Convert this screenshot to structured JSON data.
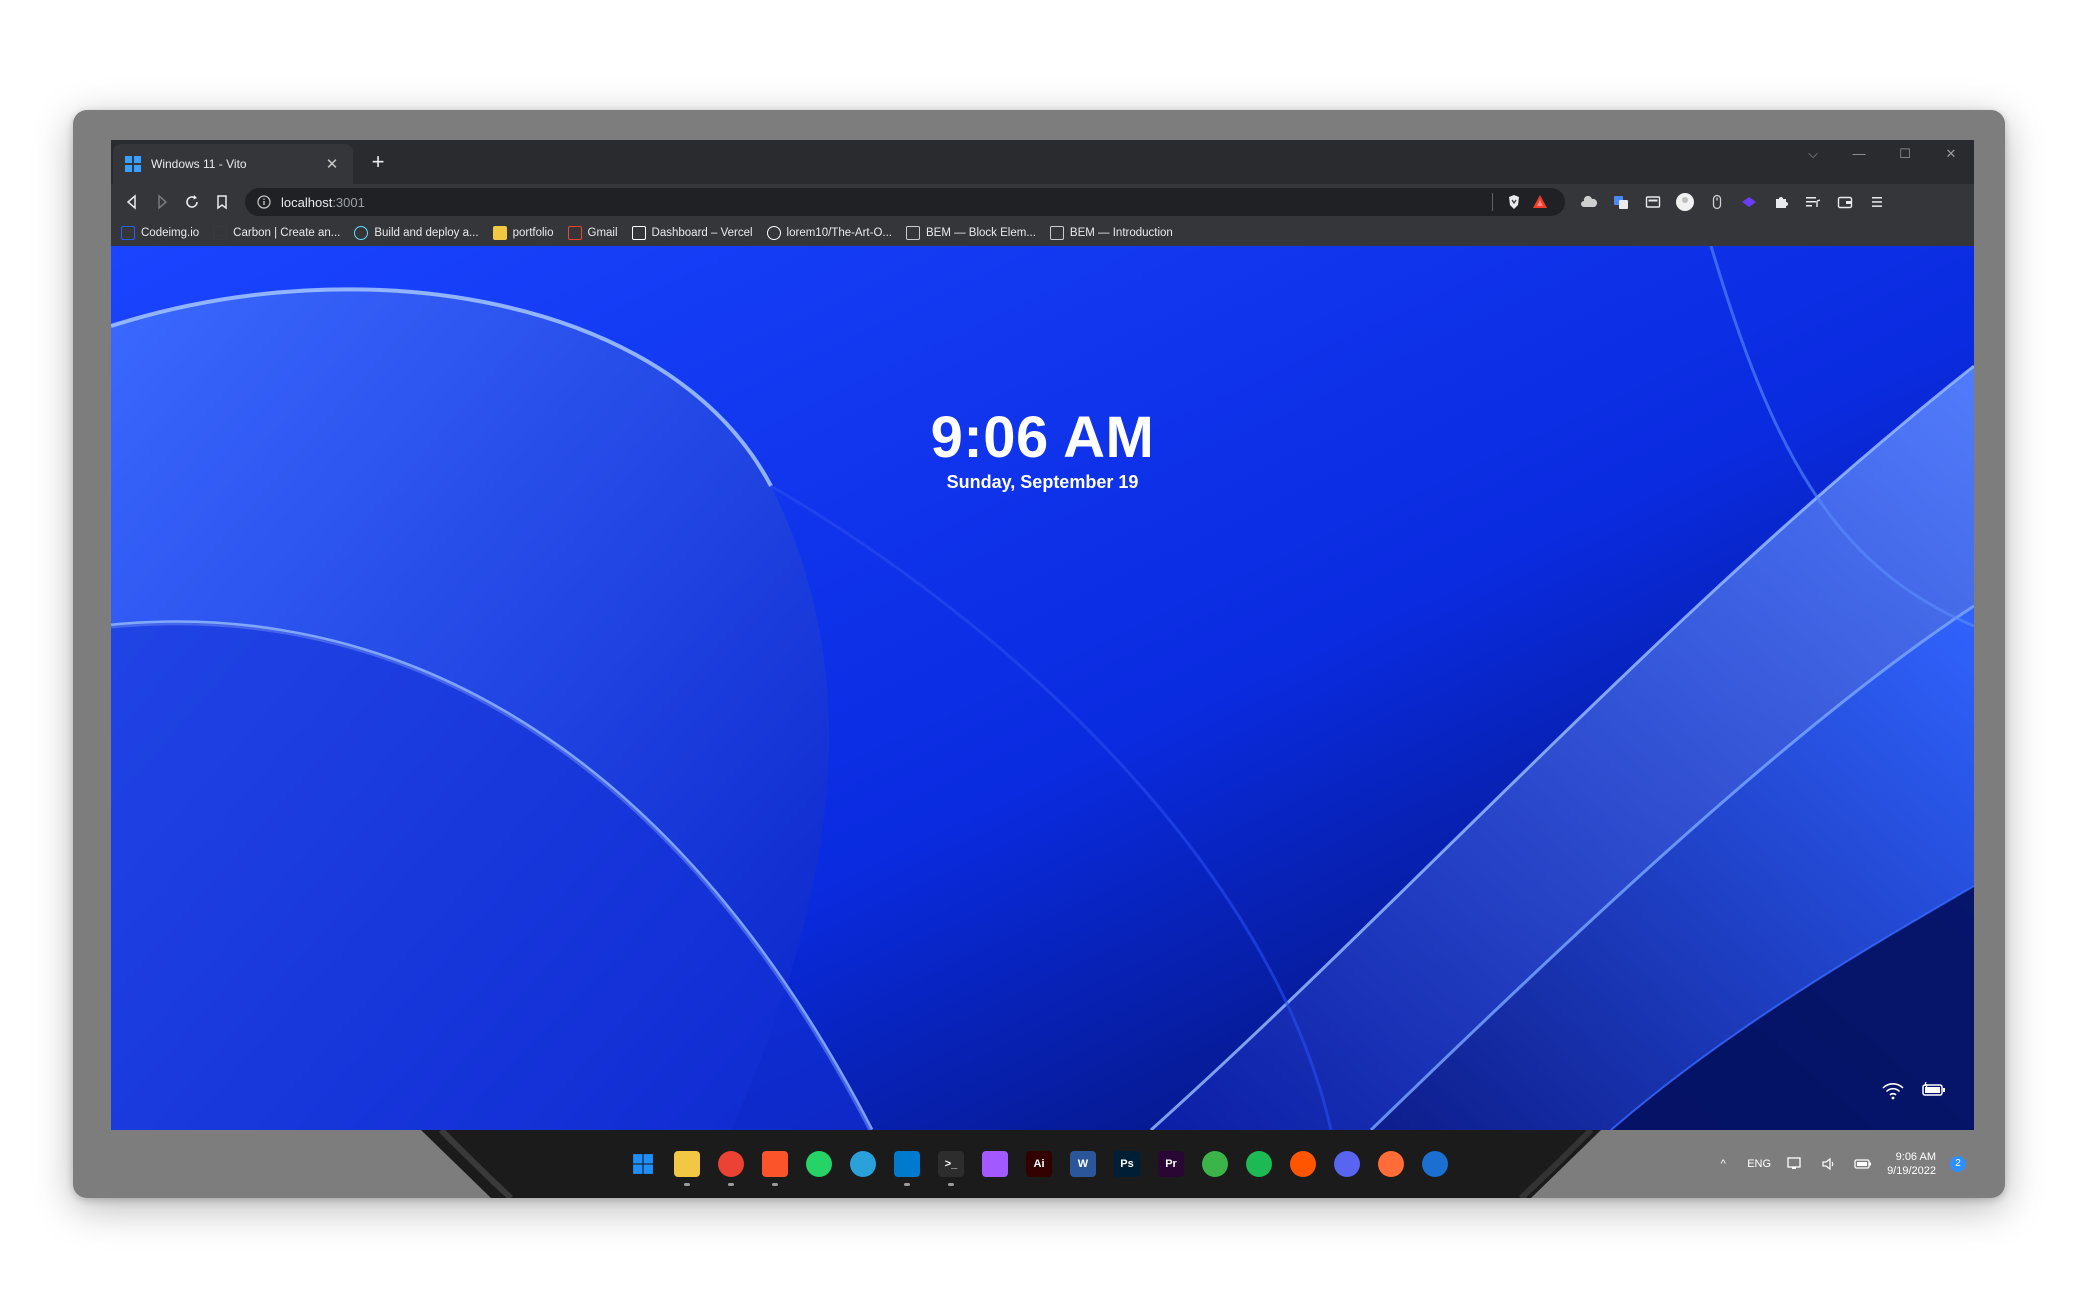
{
  "tab": {
    "title": "Windows 11 - Vito",
    "favicon": "windows-logo-icon",
    "close": "✕",
    "new_tab": "+"
  },
  "window_controls": {
    "dropdown": "⌵",
    "minimize": "—",
    "maximize": "☐",
    "close": "✕"
  },
  "omnibox": {
    "host": "localhost",
    "port": ":3001"
  },
  "bookmarks": [
    {
      "label": "Codeimg.io",
      "icon": "codeimg-icon",
      "color": "#2b5cff"
    },
    {
      "label": "Carbon | Create an...",
      "icon": "carbon-icon",
      "color": "#3a3a3a"
    },
    {
      "label": "Build and deploy a...",
      "icon": "react-icon",
      "color": "#61dafb"
    },
    {
      "label": "portfolio",
      "icon": "folder-icon",
      "color": "#f2c744"
    },
    {
      "label": "Gmail",
      "icon": "gmail-icon",
      "color": "#ea4335"
    },
    {
      "label": "Dashboard – Vercel",
      "icon": "vercel-icon",
      "color": "#ffffff"
    },
    {
      "label": "lorem10/The-Art-O...",
      "icon": "github-icon",
      "color": "#ffffff"
    },
    {
      "label": "BEM — Block Elem...",
      "icon": "bem-icon",
      "color": "#cccccc"
    },
    {
      "label": "BEM — Introduction",
      "icon": "bem-icon",
      "color": "#cccccc"
    }
  ],
  "lockscreen": {
    "time": "9:06 AM",
    "date": "Sunday, September 19"
  },
  "taskbar": {
    "apps": [
      {
        "name": "start-button",
        "icon": "windows-logo-icon",
        "bg": "#1f8fff",
        "glyph": ""
      },
      {
        "name": "file-explorer",
        "icon": "folder-icon",
        "bg": "#f2c744",
        "glyph": ""
      },
      {
        "name": "chrome",
        "icon": "chrome-icon",
        "bg": "#ea4335",
        "glyph": ""
      },
      {
        "name": "brave",
        "icon": "brave-icon",
        "bg": "#fb542b",
        "glyph": ""
      },
      {
        "name": "whatsapp",
        "icon": "whatsapp-icon",
        "bg": "#25d366",
        "glyph": ""
      },
      {
        "name": "telegram",
        "icon": "telegram-icon",
        "bg": "#2aa1da",
        "glyph": ""
      },
      {
        "name": "vscode",
        "icon": "vscode-icon",
        "bg": "#007acc",
        "glyph": ""
      },
      {
        "name": "terminal",
        "icon": "terminal-icon",
        "bg": "#2d2d2d",
        "glyph": ">_"
      },
      {
        "name": "figma",
        "icon": "figma-icon",
        "bg": "#a259ff",
        "glyph": ""
      },
      {
        "name": "illustrator",
        "icon": "illustrator-icon",
        "bg": "#330000",
        "glyph": "Ai"
      },
      {
        "name": "word",
        "icon": "word-icon",
        "bg": "#2b579a",
        "glyph": "W"
      },
      {
        "name": "photoshop",
        "icon": "photoshop-icon",
        "bg": "#001e36",
        "glyph": "Ps"
      },
      {
        "name": "premiere",
        "icon": "premiere-icon",
        "bg": "#2a0634",
        "glyph": "Pr"
      },
      {
        "name": "vpn",
        "icon": "vpn-icon",
        "bg": "#3bb54a",
        "glyph": ""
      },
      {
        "name": "spotify",
        "icon": "spotify-icon",
        "bg": "#1db954",
        "glyph": ""
      },
      {
        "name": "soundcloud",
        "icon": "soundcloud-icon",
        "bg": "#ff5500",
        "glyph": ""
      },
      {
        "name": "discord",
        "icon": "discord-icon",
        "bg": "#5865f2",
        "glyph": ""
      },
      {
        "name": "postman",
        "icon": "postman-icon",
        "bg": "#ff6c37",
        "glyph": ""
      },
      {
        "name": "steam",
        "icon": "steam-icon",
        "bg": "#1b6fd1",
        "glyph": ""
      }
    ],
    "tray": {
      "chevron": "^",
      "language": "ENG",
      "time": "9:06 AM",
      "date": "9/19/2022",
      "notifications": "2"
    }
  },
  "colors": {
    "accent": "#1f4bff",
    "taskbar": "#202020",
    "chrome": "#35363a"
  }
}
